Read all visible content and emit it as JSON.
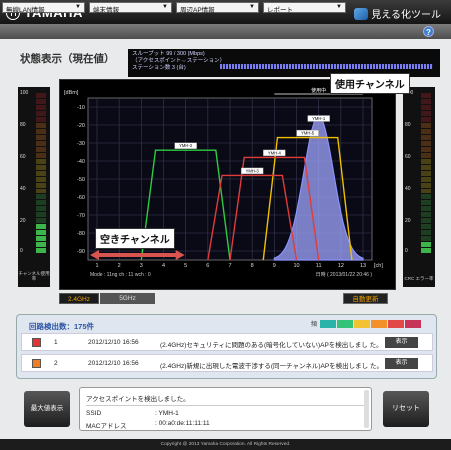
{
  "header": {
    "brand": "YAMAHA",
    "app_title": "見える化ツール"
  },
  "menus": [
    {
      "label": "無線LAN情報"
    },
    {
      "label": "端末情報"
    },
    {
      "label": "周辺AP情報"
    },
    {
      "label": "レポート"
    }
  ],
  "help_label": "?",
  "page_title": "状態表示（現在値）",
  "infobox": {
    "line1": "スループット        99 / 300 (Mbps)",
    "line2": "（アクセスポイント⇔ステーション）",
    "line3": "ステーション数  3 (台)"
  },
  "left_meter": {
    "scale": [
      "100",
      "80",
      "60",
      "40",
      "20",
      "0"
    ],
    "caption": "チャンネル使用率"
  },
  "right_meter": {
    "scale": [
      "100",
      "80",
      "60",
      "40",
      "20",
      "0"
    ],
    "caption": "CRC エラー率"
  },
  "chart_data": {
    "type": "area",
    "ylabel": "[dBm]",
    "xlabel": "[ch]",
    "y_ticks": [
      "-10",
      "-20",
      "-30",
      "-40",
      "-50",
      "-60",
      "-70",
      "-80",
      "-90"
    ],
    "x_ticks": [
      "1",
      "2",
      "3",
      "4",
      "5",
      "6",
      "7",
      "8",
      "9",
      "10",
      "11",
      "12",
      "13"
    ],
    "xlim": [
      1,
      13
    ],
    "ylim": [
      -95,
      -5
    ],
    "in_use_label": "使用中",
    "footer_info": "Mode : 11ng   ch : 11   wch : 0",
    "timestamp": "日時 ( 2013/01/22 20:46 )",
    "series": [
      {
        "name": "YMH-1",
        "color": "#8a93ff",
        "shape": "bell",
        "center": 11,
        "width": 4,
        "peak": -15,
        "fill": true
      },
      {
        "name": "YMH-5",
        "color": "#f0c000",
        "shape": "trap",
        "start": 8.5,
        "end": 12.5,
        "top": -27
      },
      {
        "name": "YMH-2",
        "color": "#2ecc40",
        "shape": "trap",
        "start": 3,
        "end": 7,
        "top": -34
      },
      {
        "name": "YMH-4",
        "color": "#e23b3b",
        "shape": "trap",
        "start": 7,
        "end": 11,
        "top": -38
      },
      {
        "name": "YMH-3",
        "color": "#e23b3b",
        "shape": "trap",
        "start": 6,
        "end": 10,
        "top": -48
      }
    ]
  },
  "callouts": {
    "used_channel": "使用チャンネル",
    "free_channel": "空きチャンネル"
  },
  "buttons": {
    "band_24": "2.4GHz",
    "band_5": "5GHz",
    "auto_update": "自動更新",
    "max_display": "最大値表示",
    "reset": "リセット"
  },
  "detection": {
    "count_label": "回路検出数：175件",
    "legend_label": "頻",
    "legend_colors": [
      "#2ab3a8",
      "#33c47a",
      "#f2c233",
      "#f2902a",
      "#e34848",
      "#c8335a"
    ],
    "rows": [
      {
        "no": "1",
        "date": "2012/12/10 16:56",
        "message": "(2.4GHz)セキュリティに問題のある(暗号化していない)APを検出しまし た。",
        "button": "表示",
        "color": "#e23535"
      },
      {
        "no": "2",
        "date": "2012/12/10 16:56",
        "message": "(2.4GHz)新規に出現した電波干渉する(同一チャンネル)APを検出しまし た。",
        "button": "表示",
        "color": "#f07c24"
      }
    ]
  },
  "message": {
    "title": "アクセスポイントを検出しました。",
    "ssid_label": "SSID",
    "ssid_value": ": YMH-1",
    "mac_label": "MACアドレス",
    "mac_value": ": 00:a0:de:11:11:11"
  },
  "footer": "Copyright @ 2013 Yamaha Corporation. All Rights Reserved."
}
